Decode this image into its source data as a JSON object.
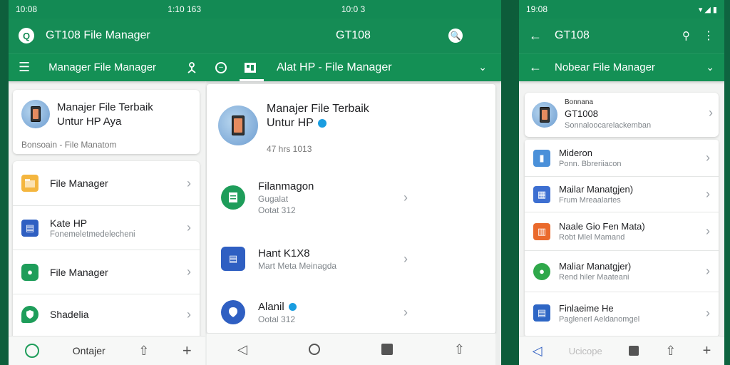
{
  "screen1": {
    "status_left": "10:08",
    "status_mid": "1:10 163",
    "app_title": "GT108 File Manager",
    "subtitle": "Manager File Manager",
    "header_card": {
      "title_line1": "Manajer File Terbaik",
      "title_line2": "Untur HP Aya",
      "footer": "Bonsoain - File Manatom"
    },
    "items": [
      {
        "title": "File Manager",
        "sub": ""
      },
      {
        "title": "Kate HP",
        "sub": "Fonemeletmedelecheni"
      },
      {
        "title": "File Manager",
        "sub": ""
      },
      {
        "title": "Shadelia",
        "sub": ""
      }
    ],
    "bottom_label": "Ontajer"
  },
  "screen2": {
    "status_mid": "10:0 3",
    "app_title": "GT108",
    "tab_title": "Alat HP - File Manager",
    "header_card": {
      "title_line1": "Manajer File Terbaik",
      "title_line2": "Untur HP",
      "footer": "47 hrs 1013"
    },
    "items": [
      {
        "title": "Filanmagon",
        "sub1": "Gugalat",
        "sub2": "Ootat 312"
      },
      {
        "title": "Hant K1X8",
        "sub1": "Mart Meta Meinagda",
        "sub2": ""
      },
      {
        "title": "Alanil",
        "sub1": "Ootal 312",
        "sub2": ""
      }
    ]
  },
  "screen3": {
    "status_left": "19:08",
    "app_title": "GT108",
    "subtitle": "Nobear File Manager",
    "header_card": {
      "label": "Bonnana",
      "title": "GT1008",
      "sub": "Sonnaloocarelackemban"
    },
    "items": [
      {
        "title": "Mideron",
        "sub": "Ponn. Bbreriiacon",
        "color": "#4a90d9"
      },
      {
        "title": "Mailar Manatgjen)",
        "sub": "Frum Mreaalartes",
        "color": "#3d6fd1"
      },
      {
        "title": "Naale Gio Fen Mata)",
        "sub": "Robt Mlel Mamand",
        "color": "#ea6a2c"
      },
      {
        "title": "Maliar Manatgjer)",
        "sub": "Rend hiler Maateani",
        "color": "#2fa84a"
      },
      {
        "title": "Finlaeime He",
        "sub": "Paglenerl Aeldanomgel",
        "color": "#2e66c5"
      }
    ],
    "bottom_label": "Ucicope"
  },
  "colors": {
    "primary": "#158c55",
    "status": "#138a54",
    "icon_green": "#1e9d5a",
    "icon_blue": "#2f5fc2",
    "icon_yellow": "#f4b63f"
  }
}
